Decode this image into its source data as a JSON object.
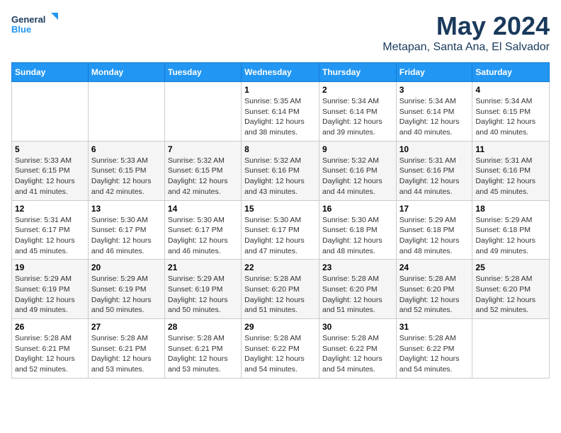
{
  "header": {
    "logo_line1": "General",
    "logo_line2": "Blue",
    "month": "May 2024",
    "location": "Metapan, Santa Ana, El Salvador"
  },
  "weekdays": [
    "Sunday",
    "Monday",
    "Tuesday",
    "Wednesday",
    "Thursday",
    "Friday",
    "Saturday"
  ],
  "weeks": [
    [
      {
        "day": "",
        "info": ""
      },
      {
        "day": "",
        "info": ""
      },
      {
        "day": "",
        "info": ""
      },
      {
        "day": "1",
        "info": "Sunrise: 5:35 AM\nSunset: 6:14 PM\nDaylight: 12 hours\nand 38 minutes."
      },
      {
        "day": "2",
        "info": "Sunrise: 5:34 AM\nSunset: 6:14 PM\nDaylight: 12 hours\nand 39 minutes."
      },
      {
        "day": "3",
        "info": "Sunrise: 5:34 AM\nSunset: 6:14 PM\nDaylight: 12 hours\nand 40 minutes."
      },
      {
        "day": "4",
        "info": "Sunrise: 5:34 AM\nSunset: 6:15 PM\nDaylight: 12 hours\nand 40 minutes."
      }
    ],
    [
      {
        "day": "5",
        "info": "Sunrise: 5:33 AM\nSunset: 6:15 PM\nDaylight: 12 hours\nand 41 minutes."
      },
      {
        "day": "6",
        "info": "Sunrise: 5:33 AM\nSunset: 6:15 PM\nDaylight: 12 hours\nand 42 minutes."
      },
      {
        "day": "7",
        "info": "Sunrise: 5:32 AM\nSunset: 6:15 PM\nDaylight: 12 hours\nand 42 minutes."
      },
      {
        "day": "8",
        "info": "Sunrise: 5:32 AM\nSunset: 6:16 PM\nDaylight: 12 hours\nand 43 minutes."
      },
      {
        "day": "9",
        "info": "Sunrise: 5:32 AM\nSunset: 6:16 PM\nDaylight: 12 hours\nand 44 minutes."
      },
      {
        "day": "10",
        "info": "Sunrise: 5:31 AM\nSunset: 6:16 PM\nDaylight: 12 hours\nand 44 minutes."
      },
      {
        "day": "11",
        "info": "Sunrise: 5:31 AM\nSunset: 6:16 PM\nDaylight: 12 hours\nand 45 minutes."
      }
    ],
    [
      {
        "day": "12",
        "info": "Sunrise: 5:31 AM\nSunset: 6:17 PM\nDaylight: 12 hours\nand 45 minutes."
      },
      {
        "day": "13",
        "info": "Sunrise: 5:30 AM\nSunset: 6:17 PM\nDaylight: 12 hours\nand 46 minutes."
      },
      {
        "day": "14",
        "info": "Sunrise: 5:30 AM\nSunset: 6:17 PM\nDaylight: 12 hours\nand 46 minutes."
      },
      {
        "day": "15",
        "info": "Sunrise: 5:30 AM\nSunset: 6:17 PM\nDaylight: 12 hours\nand 47 minutes."
      },
      {
        "day": "16",
        "info": "Sunrise: 5:30 AM\nSunset: 6:18 PM\nDaylight: 12 hours\nand 48 minutes."
      },
      {
        "day": "17",
        "info": "Sunrise: 5:29 AM\nSunset: 6:18 PM\nDaylight: 12 hours\nand 48 minutes."
      },
      {
        "day": "18",
        "info": "Sunrise: 5:29 AM\nSunset: 6:18 PM\nDaylight: 12 hours\nand 49 minutes."
      }
    ],
    [
      {
        "day": "19",
        "info": "Sunrise: 5:29 AM\nSunset: 6:19 PM\nDaylight: 12 hours\nand 49 minutes."
      },
      {
        "day": "20",
        "info": "Sunrise: 5:29 AM\nSunset: 6:19 PM\nDaylight: 12 hours\nand 50 minutes."
      },
      {
        "day": "21",
        "info": "Sunrise: 5:29 AM\nSunset: 6:19 PM\nDaylight: 12 hours\nand 50 minutes."
      },
      {
        "day": "22",
        "info": "Sunrise: 5:28 AM\nSunset: 6:20 PM\nDaylight: 12 hours\nand 51 minutes."
      },
      {
        "day": "23",
        "info": "Sunrise: 5:28 AM\nSunset: 6:20 PM\nDaylight: 12 hours\nand 51 minutes."
      },
      {
        "day": "24",
        "info": "Sunrise: 5:28 AM\nSunset: 6:20 PM\nDaylight: 12 hours\nand 52 minutes."
      },
      {
        "day": "25",
        "info": "Sunrise: 5:28 AM\nSunset: 6:20 PM\nDaylight: 12 hours\nand 52 minutes."
      }
    ],
    [
      {
        "day": "26",
        "info": "Sunrise: 5:28 AM\nSunset: 6:21 PM\nDaylight: 12 hours\nand 52 minutes."
      },
      {
        "day": "27",
        "info": "Sunrise: 5:28 AM\nSunset: 6:21 PM\nDaylight: 12 hours\nand 53 minutes."
      },
      {
        "day": "28",
        "info": "Sunrise: 5:28 AM\nSunset: 6:21 PM\nDaylight: 12 hours\nand 53 minutes."
      },
      {
        "day": "29",
        "info": "Sunrise: 5:28 AM\nSunset: 6:22 PM\nDaylight: 12 hours\nand 54 minutes."
      },
      {
        "day": "30",
        "info": "Sunrise: 5:28 AM\nSunset: 6:22 PM\nDaylight: 12 hours\nand 54 minutes."
      },
      {
        "day": "31",
        "info": "Sunrise: 5:28 AM\nSunset: 6:22 PM\nDaylight: 12 hours\nand 54 minutes."
      },
      {
        "day": "",
        "info": ""
      }
    ]
  ]
}
